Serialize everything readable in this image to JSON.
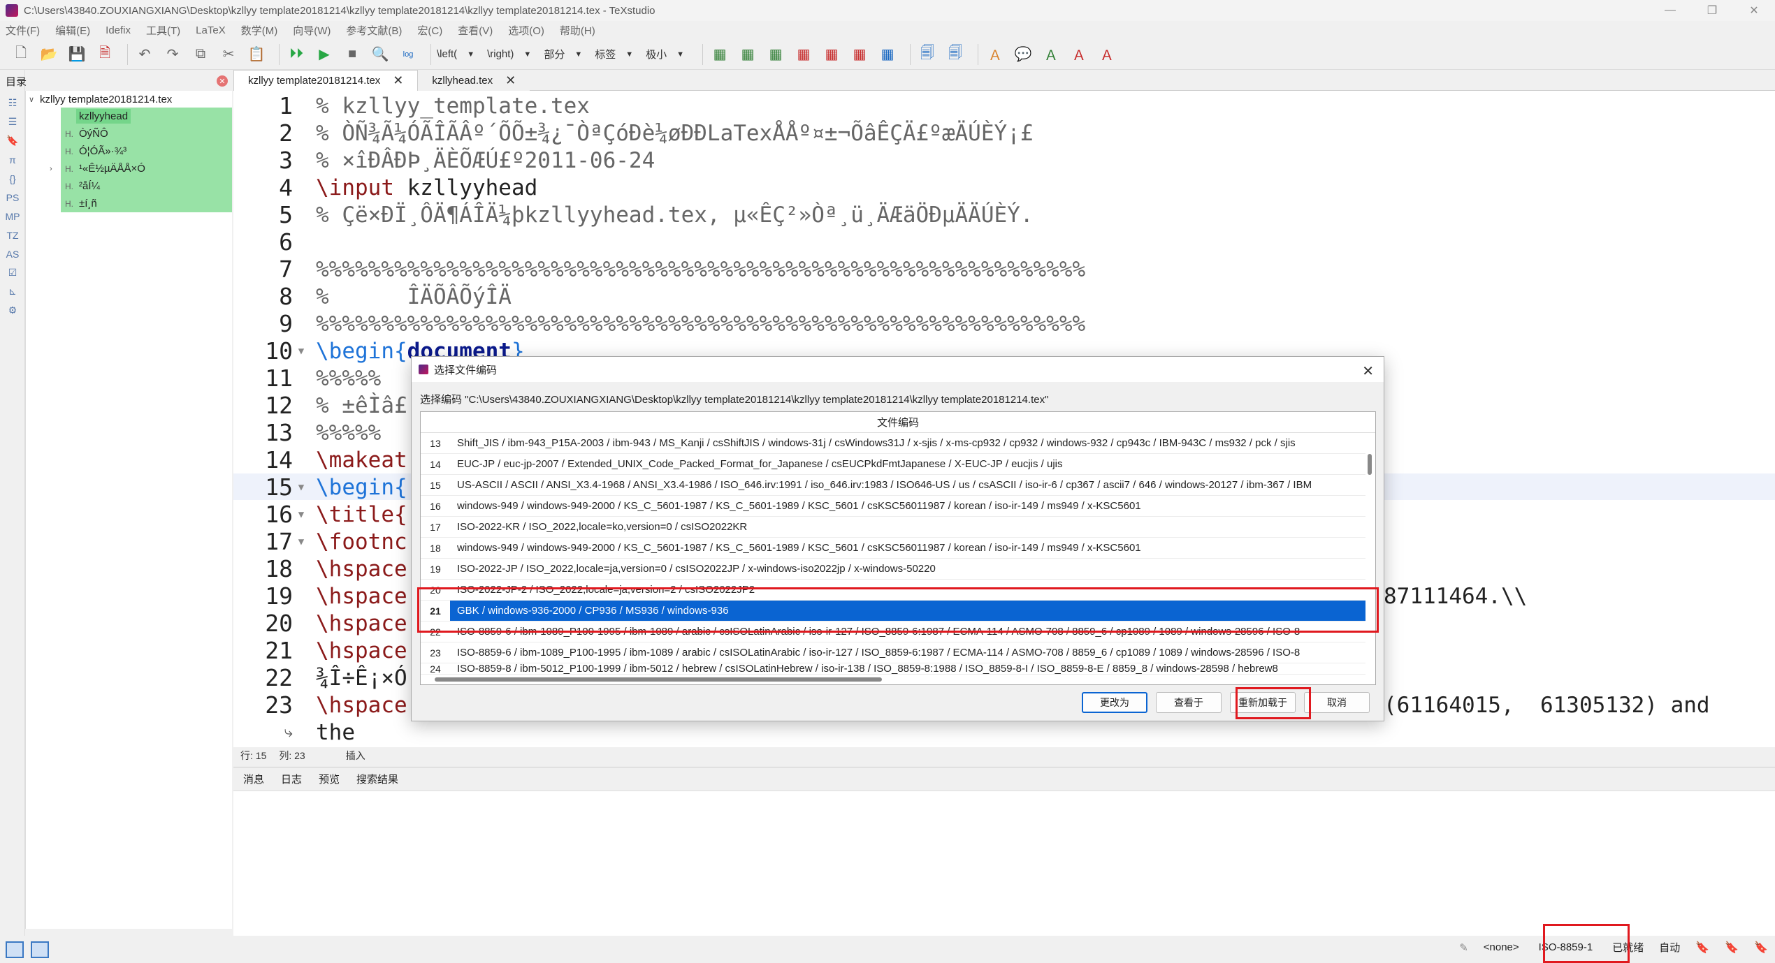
{
  "window": {
    "title": "C:\\Users\\43840.ZOUXIANGXIANG\\Desktop\\kzllyy template20181214\\kzllyy template20181214\\kzllyy template20181214.tex - TeXstudio",
    "minimize": "—",
    "maximize": "❐",
    "close": "✕"
  },
  "menu": [
    "文件(F)",
    "编辑(E)",
    "Idefix",
    "工具(T)",
    "LaTeX",
    "数学(M)",
    "向导(W)",
    "参考文献(B)",
    "宏(C)",
    "查看(V)",
    "选项(O)",
    "帮助(H)"
  ],
  "toolbar": {
    "left_label": "\\left(",
    "right_label": "\\right)",
    "part_label": "部分",
    "label_label": "标签",
    "size_label": "极小",
    "log_label": "log"
  },
  "structure": {
    "title": "目录",
    "root": "kzllyy template20181214.tex",
    "items": [
      {
        "marker": "",
        "label": "kzllyyhead"
      },
      {
        "marker": "H.",
        "label": "ÒýÑÔ"
      },
      {
        "marker": "H.",
        "label": "Ó¦ÓÃ»·¾³"
      },
      {
        "marker": "H.",
        "label": "¹«Ê½µÄÅÅ×Ó"
      },
      {
        "marker": "H.",
        "label": "²åÍ¼"
      },
      {
        "marker": "H.",
        "label": "±í¸ñ"
      }
    ]
  },
  "tabs": [
    {
      "label": "kzllyy template20181214.tex"
    },
    {
      "label": "kzllyhead.tex"
    }
  ],
  "editor": {
    "lines": [
      {
        "n": "1",
        "text": "% kzllyy_template.tex"
      },
      {
        "n": "2",
        "text": "% ÒÑ¾Ã¼ÓÃÎÃÂº´ÕÕ±¾¿¯ÒªÇóÐè¼øÐÐLaTexÅÅº¤±¬ÕâÊÇÄ£ºæÄÚÈÝ¡£"
      },
      {
        "n": "3",
        "text": "% ×îÐÂÐÞ¸ÄÈÕÆÚ£º2011-06-24"
      },
      {
        "n": "4",
        "cmd": "\\input",
        "arg": " kzllyyhead"
      },
      {
        "n": "5",
        "text": "% Çë×ÐÏ¸ÔÄ¶ÁÎÄ¼þkzllyyhead.tex, µ«ÊÇ²»Òª¸ü¸ÄÆäÖÐµÄÄÚÈÝ."
      },
      {
        "n": "6",
        "text": ""
      },
      {
        "n": "7",
        "text": "%%%%%%%%%%%%%%%%%%%%%%%%%%%%%%%%%%%%%%%%%%%%%%%%%%%%%%%%%%%"
      },
      {
        "n": "8",
        "text": "%      ÎÄÕÂÕýÎÄ"
      },
      {
        "n": "9",
        "text": "%%%%%%%%%%%%%%%%%%%%%%%%%%%%%%%%%%%%%%%%%%%%%%%%%%%%%%%%%%%"
      },
      {
        "n": "10",
        "cmd": "\\begin{",
        "doc": "document",
        "close": "}"
      },
      {
        "n": "11",
        "text": "%%%%%"
      },
      {
        "n": "12",
        "text": "% ±êÌâ£"
      },
      {
        "n": "13",
        "text": "%%%%%"
      },
      {
        "n": "14",
        "cmd": "\\makeat"
      },
      {
        "n": "15",
        "blue": "\\begin{"
      },
      {
        "n": "16",
        "cmd": "\\title{"
      },
      {
        "n": "17",
        "cmd": "\\footnc"
      },
      {
        "n": "18",
        "cmd": "\\hspace"
      },
      {
        "n": "19",
        "cmd": "\\hspace",
        "tail": "87111464.\\\\"
      },
      {
        "n": "20",
        "cmd": "\\hspace"
      },
      {
        "n": "21",
        "cmd": "\\hspace"
      },
      {
        "n": "22",
        "text": "¾Î÷Ê¡×Ó"
      },
      {
        "n": "23",
        "cmd": "\\hspace",
        "tail": "(61164015,  61305132) and"
      },
      {
        "n": "",
        "text": "the"
      }
    ]
  },
  "position_row": {
    "row_label": "行: 15",
    "col_label": "列: 23",
    "mode": "插入"
  },
  "bottom_tabs": [
    "消息",
    "日志",
    "预览",
    "搜索结果"
  ],
  "statusbar": {
    "lang": "<none>",
    "encoding": "ISO-8859-1",
    "ready": "已就绪",
    "auto": "自动"
  },
  "dialog": {
    "title": "选择文件编码",
    "path_text": "选择编码 \"C:\\Users\\43840.ZOUXIANGXIANG\\Desktop\\kzllyy template20181214\\kzllyy template20181214\\kzllyy template20181214.tex\"",
    "column_header": "文件编码",
    "rows": [
      {
        "idx": "13",
        "value": "Shift_JIS / ibm-943_P15A-2003 / ibm-943 / MS_Kanji / csShiftJIS / windows-31j / csWindows31J / x-sjis / x-ms-cp932 / cp932 / windows-932 / cp943c / IBM-943C / ms932 / pck / sjis"
      },
      {
        "idx": "14",
        "value": "EUC-JP / euc-jp-2007 / Extended_UNIX_Code_Packed_Format_for_Japanese / csEUCPkdFmtJapanese / X-EUC-JP / eucjis / ujis"
      },
      {
        "idx": "15",
        "value": "US-ASCII / ASCII / ANSI_X3.4-1968 / ANSI_X3.4-1986 / ISO_646.irv:1991 / iso_646.irv:1983 / ISO646-US / us / csASCII / iso-ir-6 / cp367 / ascii7 / 646 / windows-20127 / ibm-367 / IBM"
      },
      {
        "idx": "16",
        "value": "windows-949 / windows-949-2000 / KS_C_5601-1987 / KS_C_5601-1989 / KSC_5601 / csKSC56011987 / korean / iso-ir-149 / ms949 / x-KSC5601"
      },
      {
        "idx": "17",
        "value": "ISO-2022-KR / ISO_2022,locale=ko,version=0 / csISO2022KR"
      },
      {
        "idx": "18",
        "value": "windows-949 / windows-949-2000 / KS_C_5601-1987 / KS_C_5601-1989 / KSC_5601 / csKSC56011987 / korean / iso-ir-149 / ms949 / x-KSC5601"
      },
      {
        "idx": "19",
        "value": "ISO-2022-JP / ISO_2022,locale=ja,version=0 / csISO2022JP / x-windows-iso2022jp / x-windows-50220"
      },
      {
        "idx": "20",
        "value": "ISO-2022-JP-2 / ISO_2022,locale=ja,version=2 / csISO2022JP2"
      },
      {
        "idx": "21",
        "value": "GBK / windows-936-2000 / CP936 / MS936 / windows-936"
      },
      {
        "idx": "22",
        "value": "ISO-8859-6 / ibm-1089_P100-1995 / ibm-1089 / arabic / csISOLatinArabic / iso-ir-127 / ISO_8859-6:1987 / ECMA-114 / ASMO-708 / 8859_6 / cp1089 / 1089 / windows-28596 / ISO-8"
      },
      {
        "idx": "23",
        "value": "ISO-8859-6 / ibm-1089_P100-1995 / ibm-1089 / arabic / csISOLatinArabic / iso-ir-127 / ISO_8859-6:1987 / ECMA-114 / ASMO-708 / 8859_6 / cp1089 / 1089 / windows-28596 / ISO-8"
      },
      {
        "idx": "24",
        "value": "ISO-8859-8 / ibm-5012_P100-1999 / ibm-5012 / hebrew / csISOLatinHebrew / iso-ir-138 / ISO_8859-8:1988 / ISO_8859-8-I / ISO_8859-8-E / 8859_8 / windows-28598 / hebrew8"
      }
    ],
    "selected_index": "21",
    "buttons": {
      "change": "更改为",
      "view": "查看于",
      "reload": "重新加载于",
      "cancel": "取消"
    }
  }
}
